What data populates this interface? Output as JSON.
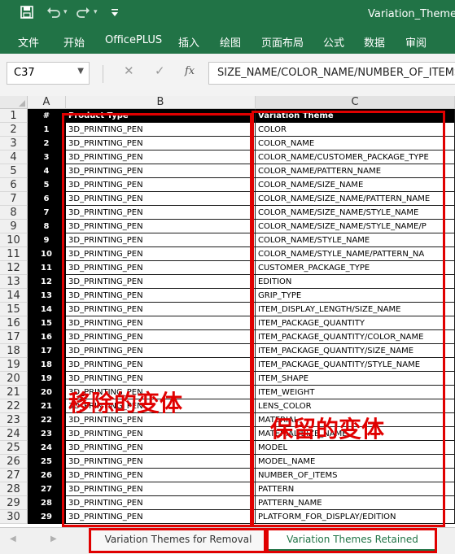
{
  "window": {
    "title": "Variation_Theme"
  },
  "quick_access": {
    "save_icon": "save-icon",
    "undo_icon": "undo-icon",
    "redo_icon": "redo-icon",
    "customize_icon": "customize-qat-icon"
  },
  "ribbon_tabs": [
    "文件",
    "开始",
    "OfficePLUS",
    "插入",
    "绘图",
    "页面布局",
    "公式",
    "数据",
    "审阅"
  ],
  "name_box": {
    "value": "C37"
  },
  "formula_bar": {
    "fx": "fx",
    "value": "SIZE_NAME/COLOR_NAME/NUMBER_OF_ITEMS"
  },
  "columns": [
    "A",
    "B",
    "C"
  ],
  "header_row": {
    "a": "#",
    "b": "Product Type",
    "c": "Variation Theme"
  },
  "rows": [
    {
      "n": "2",
      "a": "1",
      "b": "3D_PRINTING_PEN",
      "c": "COLOR"
    },
    {
      "n": "3",
      "a": "2",
      "b": "3D_PRINTING_PEN",
      "c": "COLOR_NAME"
    },
    {
      "n": "4",
      "a": "3",
      "b": "3D_PRINTING_PEN",
      "c": "COLOR_NAME/CUSTOMER_PACKAGE_TYPE"
    },
    {
      "n": "5",
      "a": "4",
      "b": "3D_PRINTING_PEN",
      "c": "COLOR_NAME/PATTERN_NAME"
    },
    {
      "n": "6",
      "a": "5",
      "b": "3D_PRINTING_PEN",
      "c": "COLOR_NAME/SIZE_NAME"
    },
    {
      "n": "7",
      "a": "6",
      "b": "3D_PRINTING_PEN",
      "c": "COLOR_NAME/SIZE_NAME/PATTERN_NAME"
    },
    {
      "n": "8",
      "a": "7",
      "b": "3D_PRINTING_PEN",
      "c": "COLOR_NAME/SIZE_NAME/STYLE_NAME"
    },
    {
      "n": "9",
      "a": "8",
      "b": "3D_PRINTING_PEN",
      "c": "COLOR_NAME/SIZE_NAME/STYLE_NAME/P"
    },
    {
      "n": "10",
      "a": "9",
      "b": "3D_PRINTING_PEN",
      "c": "COLOR_NAME/STYLE_NAME"
    },
    {
      "n": "11",
      "a": "10",
      "b": "3D_PRINTING_PEN",
      "c": "COLOR_NAME/STYLE_NAME/PATTERN_NA"
    },
    {
      "n": "12",
      "a": "11",
      "b": "3D_PRINTING_PEN",
      "c": "CUSTOMER_PACKAGE_TYPE"
    },
    {
      "n": "13",
      "a": "12",
      "b": "3D_PRINTING_PEN",
      "c": "EDITION"
    },
    {
      "n": "14",
      "a": "13",
      "b": "3D_PRINTING_PEN",
      "c": "GRIP_TYPE"
    },
    {
      "n": "15",
      "a": "14",
      "b": "3D_PRINTING_PEN",
      "c": "ITEM_DISPLAY_LENGTH/SIZE_NAME"
    },
    {
      "n": "16",
      "a": "15",
      "b": "3D_PRINTING_PEN",
      "c": "ITEM_PACKAGE_QUANTITY"
    },
    {
      "n": "17",
      "a": "16",
      "b": "3D_PRINTING_PEN",
      "c": "ITEM_PACKAGE_QUANTITY/COLOR_NAME"
    },
    {
      "n": "18",
      "a": "17",
      "b": "3D_PRINTING_PEN",
      "c": "ITEM_PACKAGE_QUANTITY/SIZE_NAME"
    },
    {
      "n": "19",
      "a": "18",
      "b": "3D_PRINTING_PEN",
      "c": "ITEM_PACKAGE_QUANTITY/STYLE_NAME"
    },
    {
      "n": "20",
      "a": "19",
      "b": "3D_PRINTING_PEN",
      "c": "ITEM_SHAPE"
    },
    {
      "n": "21",
      "a": "20",
      "b": "3D_PRINTING_PEN",
      "c": "ITEM_WEIGHT"
    },
    {
      "n": "22",
      "a": "21",
      "b": "3D_PRINTING_PEN",
      "c": "LENS_COLOR"
    },
    {
      "n": "23",
      "a": "22",
      "b": "3D_PRINTING_PEN",
      "c": "MATERIAL"
    },
    {
      "n": "24",
      "a": "23",
      "b": "3D_PRINTING_PEN",
      "c": "MATERIAL/SIZE_NAME"
    },
    {
      "n": "25",
      "a": "24",
      "b": "3D_PRINTING_PEN",
      "c": "MODEL"
    },
    {
      "n": "26",
      "a": "25",
      "b": "3D_PRINTING_PEN",
      "c": "MODEL_NAME"
    },
    {
      "n": "27",
      "a": "26",
      "b": "3D_PRINTING_PEN",
      "c": "NUMBER_OF_ITEMS"
    },
    {
      "n": "28",
      "a": "27",
      "b": "3D_PRINTING_PEN",
      "c": "PATTERN"
    },
    {
      "n": "29",
      "a": "28",
      "b": "3D_PRINTING_PEN",
      "c": "PATTERN_NAME"
    },
    {
      "n": "30",
      "a": "29",
      "b": "3D_PRINTING_PEN",
      "c": "PLATFORM_FOR_DISPLAY/EDITION"
    }
  ],
  "annotations": {
    "removed": "移除的变体",
    "retained": "保留的变体"
  },
  "sheet_tabs": [
    "Variation Themes for Removal",
    "Variation Themes Retained"
  ],
  "colors": {
    "excel_green": "#217346",
    "highlight_red": "#e00000",
    "header_black": "#000000"
  }
}
